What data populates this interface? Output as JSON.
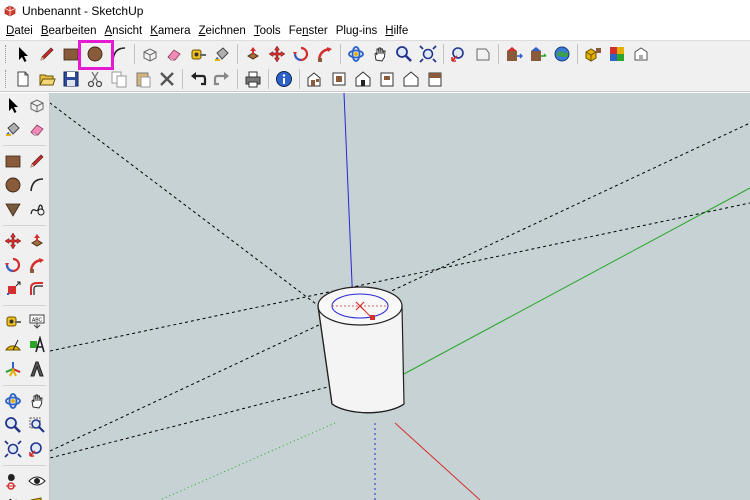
{
  "window": {
    "title": "Unbenannt - SketchUp"
  },
  "menu": [
    {
      "label": "Datei",
      "accel": "D"
    },
    {
      "label": "Bearbeiten",
      "accel": "B"
    },
    {
      "label": "Ansicht",
      "accel": "A"
    },
    {
      "label": "Kamera",
      "accel": "K"
    },
    {
      "label": "Zeichnen",
      "accel": "Z"
    },
    {
      "label": "Tools",
      "accel": "T"
    },
    {
      "label": "Fenster",
      "accel": "n"
    },
    {
      "label": "Plug-ins",
      "accel": ""
    },
    {
      "label": "Hilfe",
      "accel": "H"
    }
  ],
  "toolbar_main": [
    "select-tool",
    "pencil-tool",
    "rectangle-tool",
    "circle-tool",
    "arc-tool",
    "sep",
    "make-component-tool",
    "eraser-tool",
    "tape-measure-tool",
    "paint-bucket-tool",
    "sep",
    "push-pull-tool",
    "move-tool",
    "rotate-tool",
    "follow-me-tool",
    "sep",
    "orbit-tool",
    "pan-tool",
    "zoom-tool",
    "zoom-extents-tool",
    "sep",
    "previous-view-tool",
    "next-view-tool",
    "sep",
    "get-models-tool",
    "share-model-tool",
    "google-earth-tool",
    "sep",
    "components-tool",
    "materials-tool",
    "styles-tool"
  ],
  "toolbar_standard": [
    "new-file",
    "open-file",
    "save-file",
    "cut",
    "copy",
    "paste",
    "delete",
    "sep",
    "undo",
    "redo",
    "sep",
    "print",
    "sep",
    "model-info",
    "sep",
    "iso-view",
    "top-view",
    "front-view",
    "right-view",
    "back-view",
    "left-view"
  ],
  "active_tool": "circle-tool",
  "left_toolbar_rows": [
    [
      "select-tool",
      "make-component-tool"
    ],
    [
      "paint-bucket-tool",
      "eraser-tool"
    ],
    "sep",
    [
      "rectangle-tool",
      "line-tool"
    ],
    [
      "circle-tool",
      "arc-tool"
    ],
    [
      "polygon-tool",
      "freehand-tool"
    ],
    "sep",
    [
      "move-tool",
      "push-pull-tool"
    ],
    [
      "rotate-tool",
      "follow-me-tool"
    ],
    [
      "scale-tool",
      "offset-tool"
    ],
    "sep",
    [
      "tape-measure-tool",
      "dimension-tool"
    ],
    [
      "protractor-tool",
      "text-tool"
    ],
    [
      "axes-tool",
      "3d-text-tool"
    ],
    "sep",
    [
      "orbit-tool",
      "pan-tool"
    ],
    [
      "zoom-tool",
      "zoom-window-tool"
    ],
    [
      "zoom-extents-tool",
      "previous-view-tool"
    ],
    "sep",
    [
      "position-camera-tool",
      "look-around-tool"
    ],
    [
      "walk-tool",
      "section-plane-tool"
    ]
  ],
  "left_toolbar_labels": {
    "dimension-tool": "ABC"
  },
  "colors": {
    "viewport_bg": "#c7d2d5",
    "axis_red": "#d42f2f",
    "axis_green": "#2ba62b",
    "axis_blue": "#2828d4",
    "highlight": "#e31ad2"
  }
}
